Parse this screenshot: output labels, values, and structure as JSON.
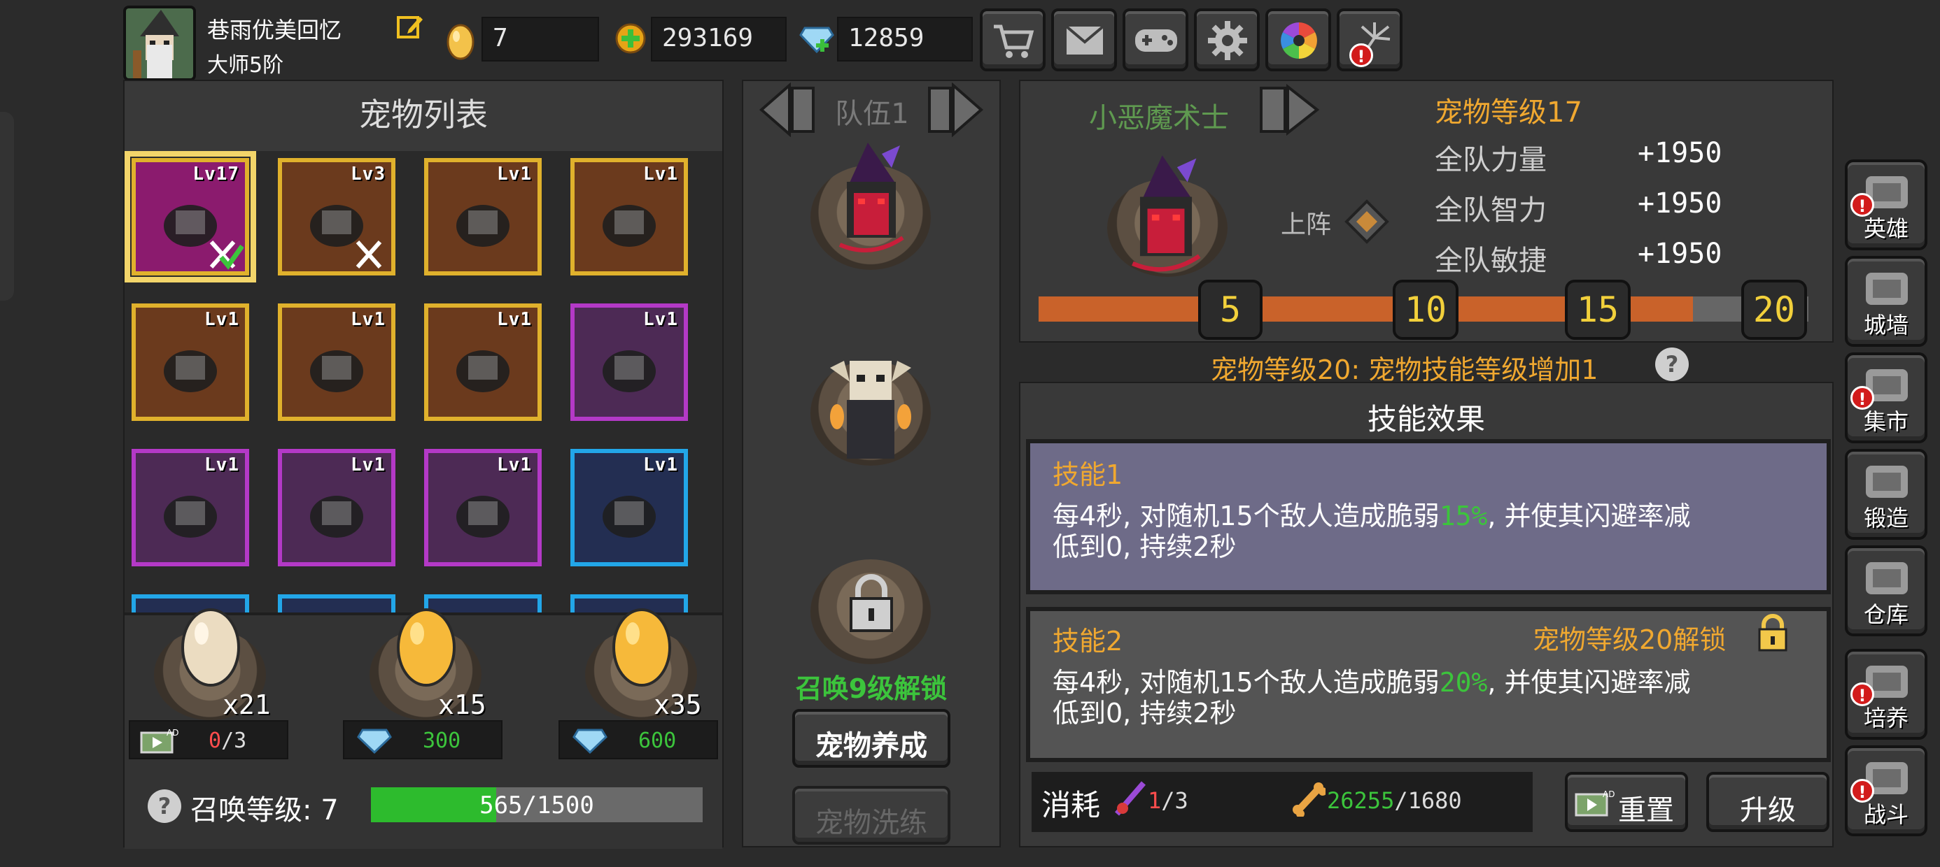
{
  "player": {
    "name": "巷雨优美回忆",
    "rank": "大师5阶"
  },
  "currency": {
    "egg_count": "7",
    "gold": "293169",
    "diamonds": "12859"
  },
  "top_buttons": [
    "cart-icon",
    "mail-icon",
    "gamepad-icon",
    "gear-icon",
    "aperture-icon",
    "firework-icon"
  ],
  "pet_list": {
    "title": "宠物列表",
    "pets": [
      {
        "level": "Lv17",
        "frame": "gold",
        "color": "#8b1b6e",
        "selected": true
      },
      {
        "level": "Lv3",
        "frame": "gold",
        "color": "#6b3a1d"
      },
      {
        "level": "Lv1",
        "frame": "gold",
        "color": "#6b3a1d"
      },
      {
        "level": "Lv1",
        "frame": "gold",
        "color": "#6b3a1d"
      },
      {
        "level": "Lv1",
        "frame": "gold",
        "color": "#6b3a1d"
      },
      {
        "level": "Lv1",
        "frame": "gold",
        "color": "#6b3a1d"
      },
      {
        "level": "Lv1",
        "frame": "gold",
        "color": "#6b3a1d"
      },
      {
        "level": "Lv1",
        "frame": "purple",
        "color": "#4d2a55"
      },
      {
        "level": "Lv1",
        "frame": "purple",
        "color": "#4d2a55"
      },
      {
        "level": "Lv1",
        "frame": "purple",
        "color": "#4d2a55"
      },
      {
        "level": "Lv1",
        "frame": "purple",
        "color": "#4d2a55"
      },
      {
        "level": "Lv1",
        "frame": "blue",
        "color": "#232e52"
      }
    ]
  },
  "eggs": [
    {
      "count": "x21",
      "cost_type": "ad",
      "cost": "0",
      "cost_max": "/3"
    },
    {
      "count": "x15",
      "cost_type": "diamond",
      "cost": "300"
    },
    {
      "count": "x35",
      "cost_type": "diamond",
      "cost": "600"
    }
  ],
  "summon": {
    "label": "召唤等级: 7",
    "progress_text": "565/1500",
    "progress": 0.377
  },
  "team": {
    "title": "队伍1",
    "locked_text": "召唤9级解锁",
    "nurture_button": "宠物养成",
    "refine_button": "宠物洗练"
  },
  "pet_detail": {
    "name": "小恶魔术士",
    "deploy_label": "上阵",
    "level_text": "宠物等级17",
    "stats": [
      {
        "name": "全队力量",
        "value": "+1950"
      },
      {
        "name": "全队智力",
        "value": "+1950"
      },
      {
        "name": "全队敏捷",
        "value": "+1950"
      }
    ],
    "milestones": [
      "5",
      "10",
      "15",
      "20"
    ],
    "level_progress": 0.85,
    "bonus_text": "宠物等级20: 宠物技能等级增加1"
  },
  "skills": {
    "title": "技能效果",
    "skill1": {
      "name": "技能1",
      "desc_a": "每4秒, 对随机15个敌人造成脆弱",
      "pct": "15%",
      "desc_b": ", 并使其闪避率减",
      "desc_c": "低到0, 持续2秒"
    },
    "skill2": {
      "name": "技能2",
      "unlock": "宠物等级20解锁",
      "desc_a": "每4秒, 对随机15个敌人造成脆弱",
      "pct": "20%",
      "desc_b": ", 并使其闪避率减",
      "desc_c": "低到0, 持续2秒"
    }
  },
  "cost": {
    "label": "消耗",
    "item1_have": "1",
    "item1_need": "/3",
    "item2_have": "26255",
    "item2_need": "/1680",
    "reset_button": "重置",
    "upgrade_button": "升级"
  },
  "side_nav": [
    {
      "label": "英雄",
      "badge": true,
      "icon": "helmet-icon"
    },
    {
      "label": "城墙",
      "badge": false,
      "icon": "wall-icon"
    },
    {
      "label": "集市",
      "badge": true,
      "icon": "market-icon"
    },
    {
      "label": "锻造",
      "badge": false,
      "icon": "anvil-icon"
    },
    {
      "label": "仓库",
      "badge": false,
      "icon": "warehouse-icon"
    },
    {
      "label": "培养",
      "badge": true,
      "icon": "trophy-icon"
    },
    {
      "label": "战斗",
      "badge": true,
      "icon": "portal-icon"
    }
  ]
}
